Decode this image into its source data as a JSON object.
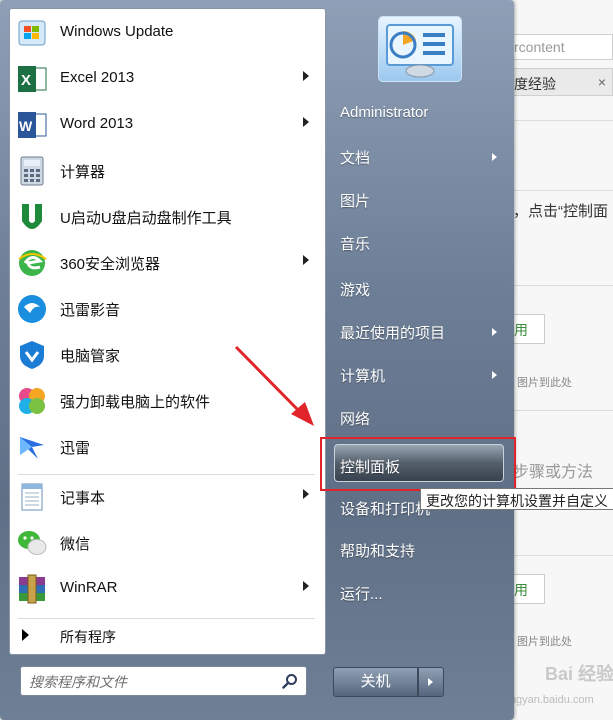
{
  "background_page": {
    "field_text": "rcontent",
    "tab_text": "度经验",
    "tab_close": "×",
    "text1": "，点击“控制面",
    "btn_text": "用",
    "hint_text": "图片到此处",
    "text2": "步骤或方法",
    "watermark": "Bai 经验",
    "watermark_url": "jingyan.baidu.com"
  },
  "start_menu": {
    "programs": [
      {
        "label": "Windows Update",
        "icon": "windows-update-icon",
        "arrow": false
      },
      {
        "label": "Excel 2013",
        "icon": "excel-icon",
        "arrow": true
      },
      {
        "label": "Word 2013",
        "icon": "word-icon",
        "arrow": true
      },
      {
        "label": "计算器",
        "icon": "calculator-icon",
        "arrow": false
      },
      {
        "label": "U启动U盘启动盘制作工具",
        "icon": "u-boot-icon",
        "arrow": false
      },
      {
        "label": "360安全浏览器",
        "icon": "browser-360-icon",
        "arrow": true
      },
      {
        "label": "迅雷影音",
        "icon": "xunlei-player-icon",
        "arrow": false
      },
      {
        "label": "电脑管家",
        "icon": "pc-manager-icon",
        "arrow": false
      },
      {
        "label": "强力卸载电脑上的软件",
        "icon": "uninstall-icon",
        "arrow": false
      },
      {
        "label": "迅雷",
        "icon": "xunlei-icon",
        "arrow": false
      },
      {
        "label": "记事本",
        "icon": "notepad-icon",
        "arrow": true
      },
      {
        "label": "微信",
        "icon": "wechat-icon",
        "arrow": false
      },
      {
        "label": "WinRAR",
        "icon": "winrar-icon",
        "arrow": true
      }
    ],
    "all_programs": "所有程序",
    "search_placeholder": "搜索程序和文件",
    "right_items": [
      {
        "label": "Administrator",
        "arrow": false
      },
      {
        "label": "文档",
        "arrow": true
      },
      {
        "label": "图片",
        "arrow": false
      },
      {
        "label": "音乐",
        "arrow": false
      },
      {
        "label": "游戏",
        "arrow": false
      },
      {
        "label": "最近使用的项目",
        "arrow": true
      },
      {
        "label": "计算机",
        "arrow": true
      },
      {
        "label": "网络",
        "arrow": false
      },
      {
        "label": "控制面板",
        "arrow": false
      },
      {
        "label": "设备和打印机",
        "arrow": false
      },
      {
        "label": "帮助和支持",
        "arrow": false
      },
      {
        "label": "运行...",
        "arrow": false
      }
    ],
    "tooltip": "更改您的计算机设置并自定义",
    "shutdown": "关机"
  },
  "colors": {
    "highlight_box": "#e0242a",
    "annotation_arrow": "#e0242a"
  }
}
